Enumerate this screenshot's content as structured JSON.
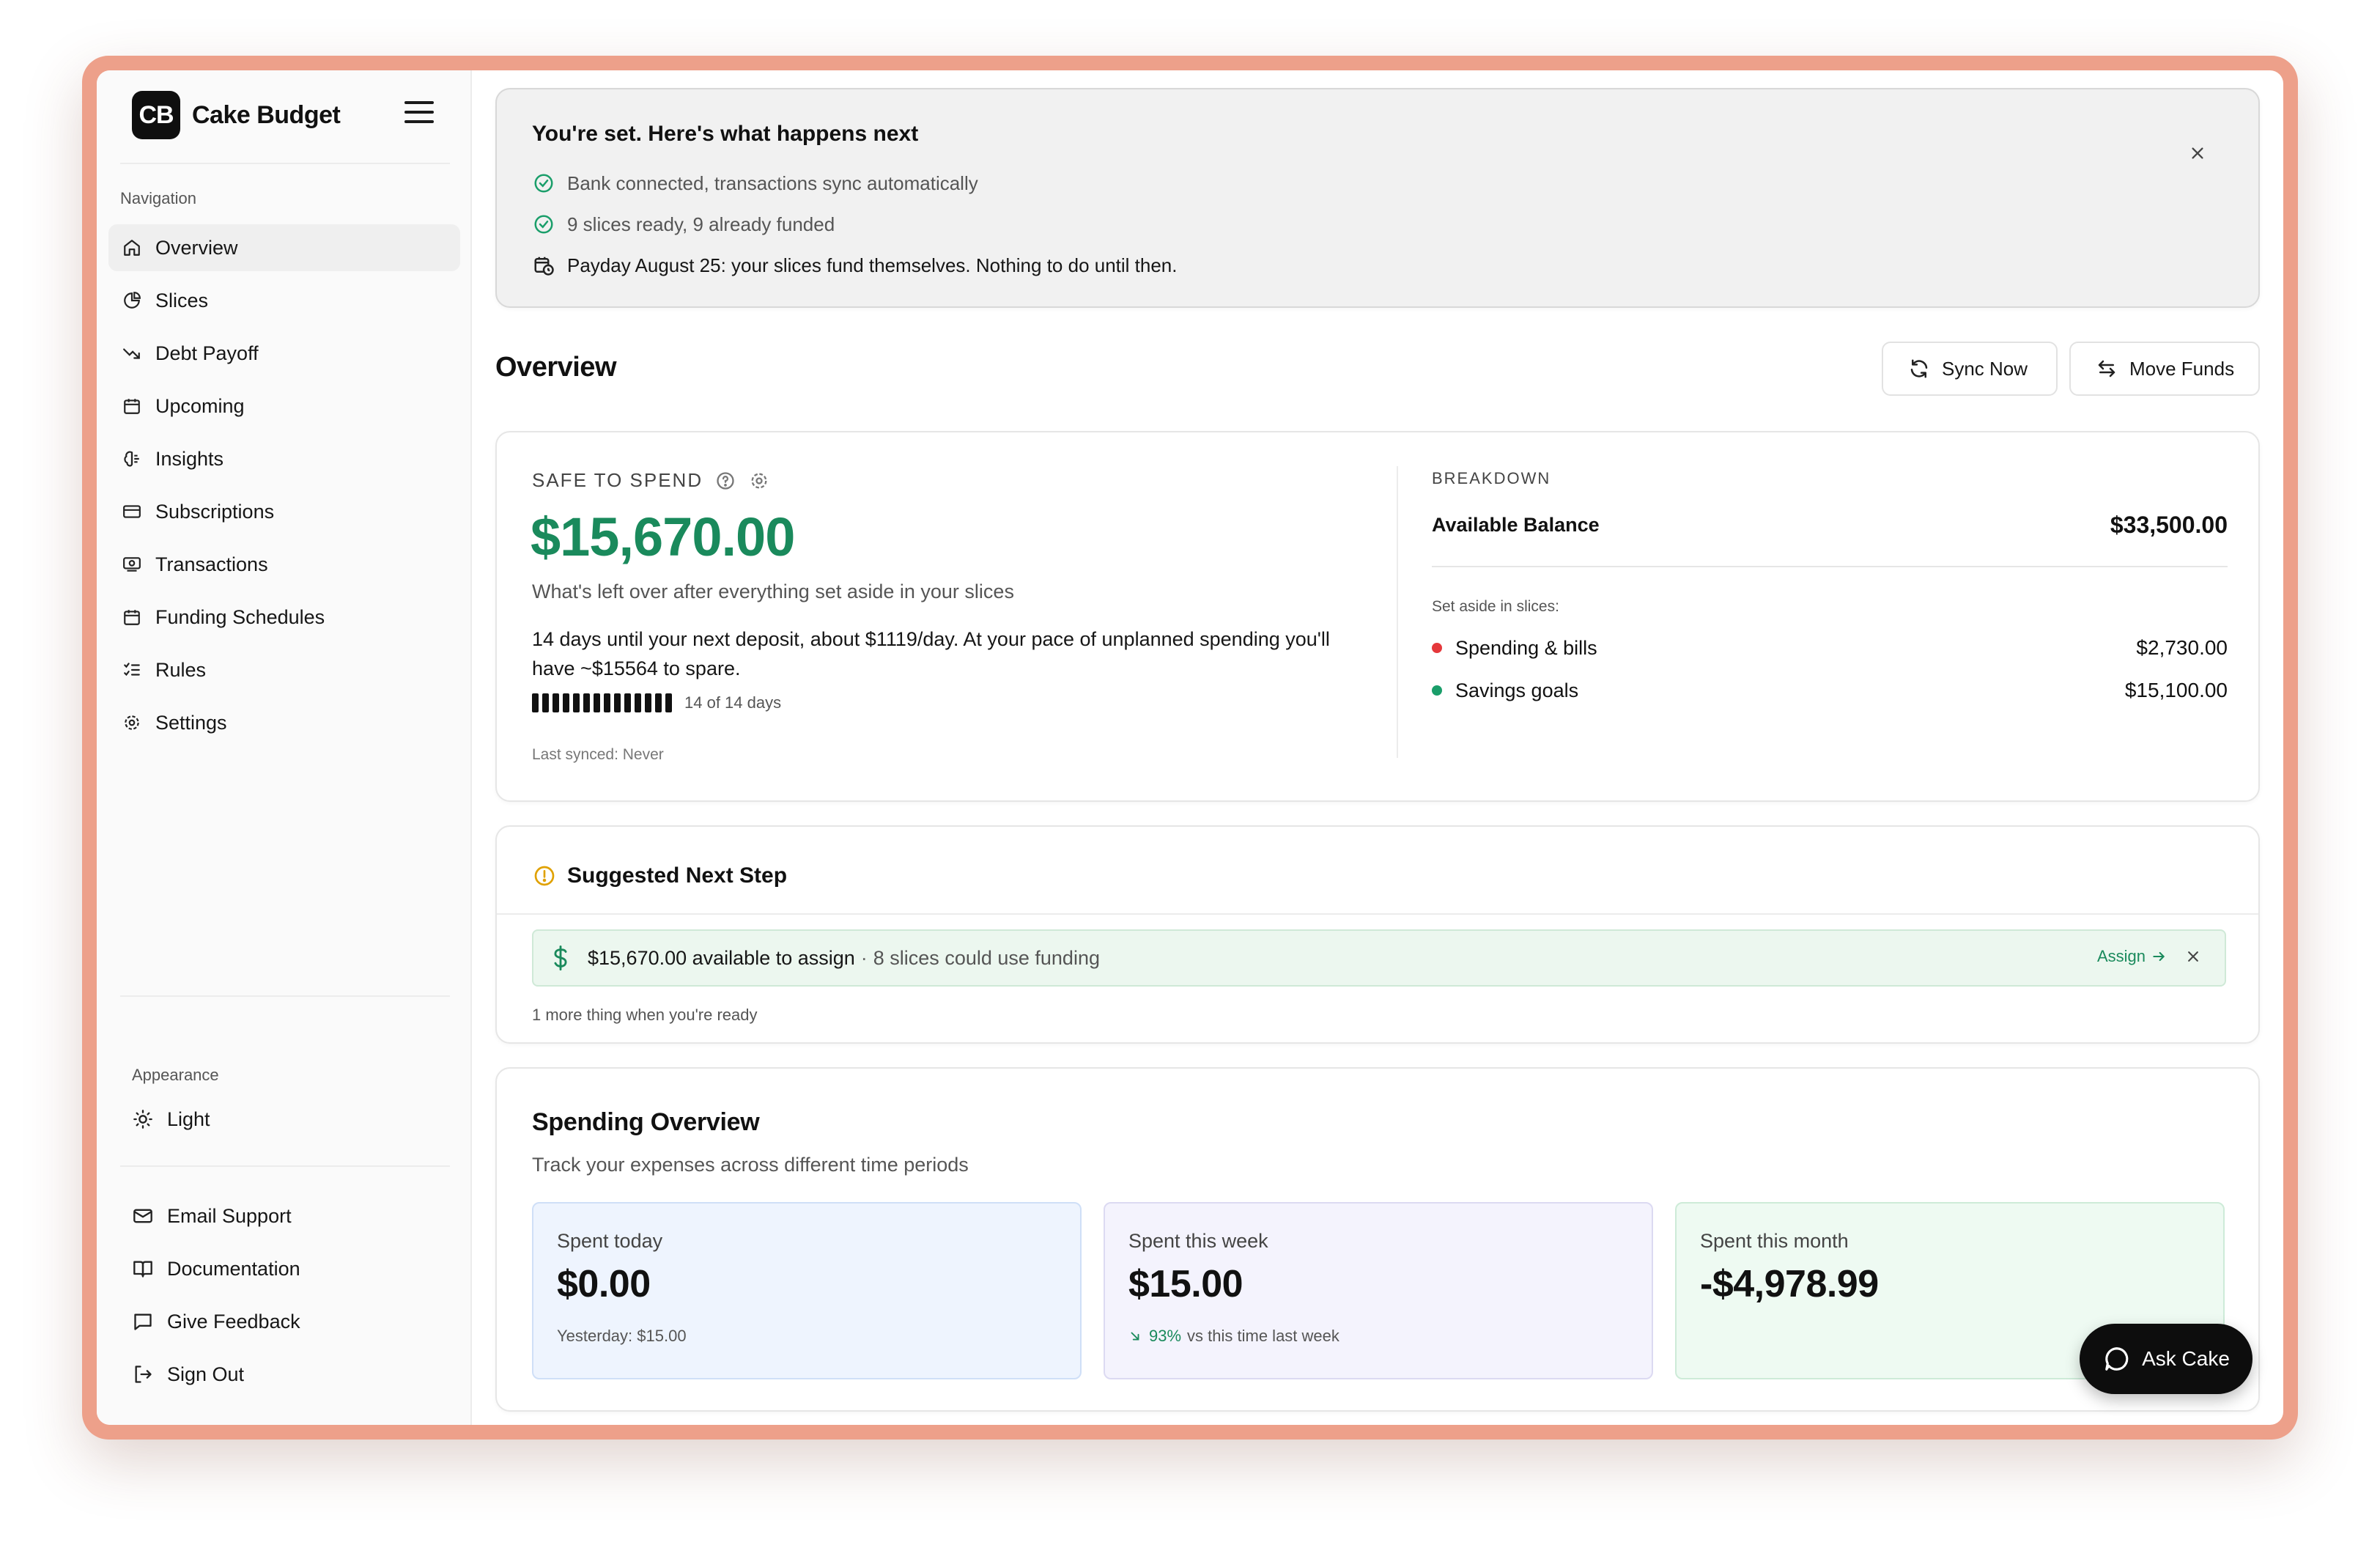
{
  "brand": {
    "logo": "CB",
    "name": "Cake Budget"
  },
  "sidebar": {
    "nav_heading": "Navigation",
    "items": [
      {
        "label": "Overview",
        "icon": "home-icon",
        "active": true
      },
      {
        "label": "Slices",
        "icon": "pie-chart-icon"
      },
      {
        "label": "Debt Payoff",
        "icon": "trending-down-icon"
      },
      {
        "label": "Upcoming",
        "icon": "calendar-icon"
      },
      {
        "label": "Insights",
        "icon": "brain-icon"
      },
      {
        "label": "Subscriptions",
        "icon": "credit-card-icon"
      },
      {
        "label": "Transactions",
        "icon": "receipt-icon"
      },
      {
        "label": "Funding Schedules",
        "icon": "calendar-icon"
      },
      {
        "label": "Rules",
        "icon": "list-checks-icon"
      },
      {
        "label": "Settings",
        "icon": "gear-icon"
      }
    ],
    "appearance_heading": "Appearance",
    "theme_label": "Light",
    "footer": [
      {
        "label": "Email Support",
        "icon": "mail-icon"
      },
      {
        "label": "Documentation",
        "icon": "book-icon"
      },
      {
        "label": "Give Feedback",
        "icon": "message-icon"
      },
      {
        "label": "Sign Out",
        "icon": "sign-out-icon"
      }
    ]
  },
  "banner": {
    "title": "You're set. Here's what happens next",
    "rows": [
      "Bank connected, transactions sync automatically",
      "9 slices ready, 9 already funded",
      "Payday August 25: your slices fund themselves. Nothing to do until then."
    ]
  },
  "header": {
    "title": "Overview",
    "sync_label": "Sync Now",
    "move_label": "Move Funds"
  },
  "safe_to_spend": {
    "label": "SAFE TO SPEND",
    "amount": "$15,670.00",
    "subtitle": "What's left over after everything set aside in your slices",
    "description": "14 days until your next deposit, about $1119/day. At your pace of unplanned spending you'll have ~$15564 to spare.",
    "days_filled": 14,
    "days_total": 14,
    "days_label": "14 of 14 days",
    "last_synced": "Last synced: Never"
  },
  "breakdown": {
    "title": "BREAKDOWN",
    "available_label": "Available Balance",
    "available_value": "$33,500.00",
    "set_aside_label": "Set aside in slices:",
    "rows": [
      {
        "label": "Spending & bills",
        "value": "$2,730.00",
        "color": "#e5383b"
      },
      {
        "label": "Savings goals",
        "value": "$15,100.00",
        "color": "#1a9e6a"
      }
    ]
  },
  "next_step": {
    "title": "Suggested Next Step",
    "amount_text": "$15,670.00 available to assign",
    "separator": "·",
    "detail": "8 slices could use funding",
    "assign_label": "Assign",
    "more": "1 more thing when you're ready"
  },
  "spending": {
    "title": "Spending Overview",
    "subtitle": "Track your expenses across different time periods",
    "tiles": [
      {
        "label": "Spent today",
        "value": "$0.00",
        "foot": "Yesterday: $15.00",
        "bg": "#eef4fe",
        "border": "#cfdff7"
      },
      {
        "label": "Spent this week",
        "value": "$15.00",
        "pct": "93%",
        "foot": "vs this time last week",
        "bg": "#f4f3fd",
        "border": "#dcdaf2"
      },
      {
        "label": "Spent this month",
        "value": "-$4,978.99",
        "bg": "#eefaf2",
        "border": "#cdebd8"
      }
    ]
  },
  "ask_button": {
    "label": "Ask Cake"
  },
  "colors": {
    "accent_green": "#1a8a5c",
    "frame": "#eda08a"
  }
}
